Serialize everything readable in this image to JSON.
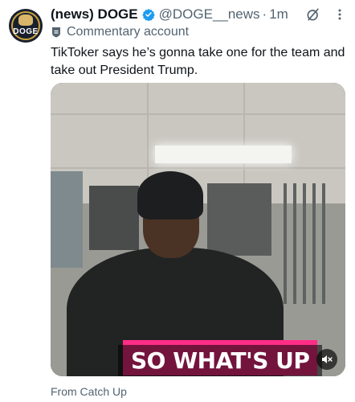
{
  "author": {
    "display_name": "(news) DOGE",
    "handle": "@DOGE__news",
    "separator": "·",
    "time": "1m",
    "avatar_text": "DOGE",
    "account_label": "Commentary account"
  },
  "tweet": {
    "text": "TikToker says he’s gonna take one for the team and take out President Trump."
  },
  "media": {
    "caption": "SO WHAT'S UP",
    "caption_bg": "#ff2d87"
  },
  "footer": {
    "source": "From Catch Up"
  },
  "colors": {
    "verified": "#1d9bf0",
    "secondary_text": "#536471",
    "primary_text": "#0f1419"
  },
  "icons": [
    "verified-badge-icon",
    "grok-icon",
    "more-icon",
    "commentary-badge-icon",
    "volume-muted-icon"
  ]
}
